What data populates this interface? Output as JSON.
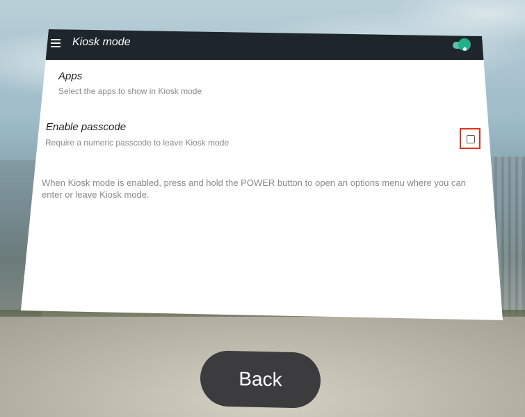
{
  "window": {
    "title": "Kiosk mode"
  },
  "header": {
    "menu_icon": "hamburger-menu-icon",
    "toggle_icon": "toggle-switch-icon",
    "toggle_state": "on",
    "accent_color": "#20b08c"
  },
  "settings": {
    "apps": {
      "title": "Apps",
      "subtitle": "Select the apps to show in Kiosk mode"
    },
    "passcode": {
      "title": "Enable passcode",
      "subtitle": "Require a numeric passcode to leave Kiosk mode",
      "checked": false,
      "highlight_color": "#e0321f"
    },
    "info_text": "When Kiosk mode is enabled, press and hold the POWER button to open an options menu where you can enter or leave Kiosk mode."
  },
  "footer": {
    "back_label": "Back"
  }
}
